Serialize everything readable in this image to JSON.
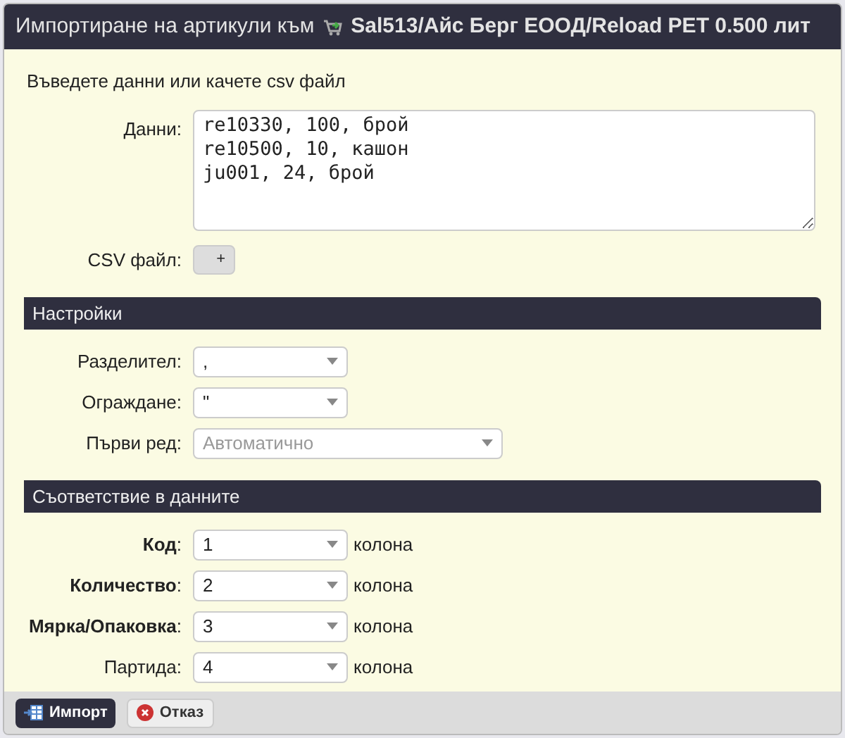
{
  "window": {
    "title_prefix": "Импортиране на артикули към",
    "title_object": "Sal513/Айс Берг ЕООД/Reload PET 0.500 лит"
  },
  "intro": "Въведете данни или качете csv файл",
  "data_field": {
    "label": "Данни:",
    "value": "re10330, 100, брой\nre10500, 10, кашон\nju001, 24, брой"
  },
  "csv_field": {
    "label": "CSV файл:",
    "button": "+"
  },
  "settings": {
    "title": "Настройки",
    "fields": [
      {
        "label": "Разделител:",
        "value": ",",
        "wide": false
      },
      {
        "label": "Ограждане:",
        "value": "\"",
        "wide": false
      },
      {
        "label": "Първи ред:",
        "placeholder": "Автоматично",
        "wide": true
      }
    ]
  },
  "mapping": {
    "title": "Съответствие в данните",
    "fields": [
      {
        "label": "**Код**:",
        "value": "1",
        "suffix": "колона"
      },
      {
        "label": "**Количество**:",
        "value": "2",
        "suffix": "колона"
      },
      {
        "label": "**Мярка/Опаковка**:",
        "value": "3",
        "suffix": "колона"
      },
      {
        "label": "Партида:",
        "value": "4",
        "suffix": "колона"
      }
    ]
  },
  "buttons": [
    {
      "label": "Импорт",
      "kind": "primary"
    },
    {
      "label": "Отказ",
      "kind": "cancel"
    }
  ]
}
